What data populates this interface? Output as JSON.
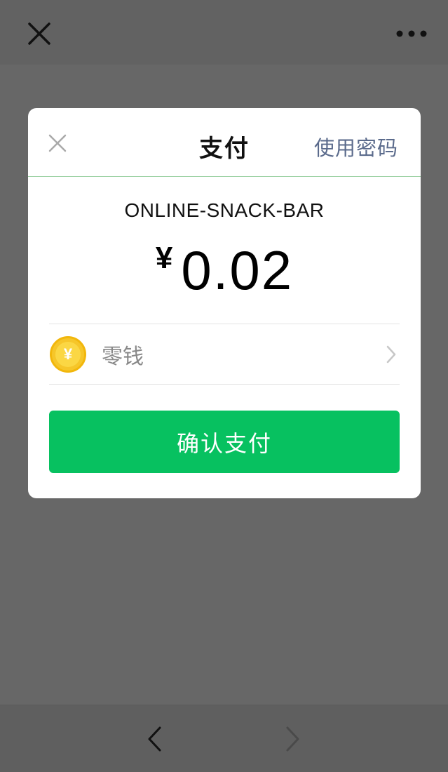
{
  "top_bar": {
    "close_icon": "close-icon",
    "more_icon": "more-icon"
  },
  "dialog": {
    "title": "支付",
    "use_password_label": "使用密码",
    "close_icon": "close-icon",
    "merchant": "ONLINE-SNACK-BAR",
    "currency_symbol": "¥",
    "amount": "0.02",
    "payment_method": {
      "icon": "coin-icon",
      "icon_glyph": "¥",
      "label": "零钱"
    },
    "confirm_label": "确认支付"
  },
  "bottom_bar": {
    "back_icon": "chevron-left-icon",
    "forward_icon": "chevron-right-icon"
  },
  "colors": {
    "overlay": "#676767",
    "accent_green": "#07c160",
    "link_blue": "#5b6b8c",
    "coin_gold": "#f6c62a"
  }
}
